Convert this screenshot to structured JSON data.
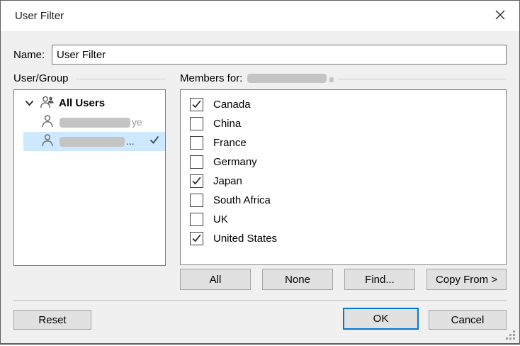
{
  "dialog": {
    "title": "User Filter"
  },
  "icons": {
    "close": "x-close",
    "tree_expander": "chevron-down",
    "group": "users-group",
    "user": "user-person",
    "selected_user_check": "check",
    "member_check": "check",
    "resize": "resize-grip"
  },
  "name_field": {
    "label": "Name:",
    "value": "User Filter"
  },
  "user_group_panel": {
    "label": "User/Group",
    "tree": [
      {
        "label": "All Users",
        "type": "group",
        "expanded": true,
        "redacted": false
      },
      {
        "type": "user",
        "redacted": true,
        "visible_suffix": "ye",
        "selected": false,
        "checked": false
      },
      {
        "type": "user",
        "redacted": true,
        "visible_suffix": "...",
        "selected": true,
        "checked": true
      }
    ]
  },
  "members_panel": {
    "label": "Members for:",
    "owner_redacted": true,
    "items": [
      {
        "label": "Canada",
        "checked": true
      },
      {
        "label": "China",
        "checked": false
      },
      {
        "label": "France",
        "checked": false
      },
      {
        "label": "Germany",
        "checked": false
      },
      {
        "label": "Japan",
        "checked": true
      },
      {
        "label": "South Africa",
        "checked": false
      },
      {
        "label": "UK",
        "checked": false
      },
      {
        "label": "United States",
        "checked": true
      }
    ],
    "buttons": [
      {
        "label": "All"
      },
      {
        "label": "None"
      },
      {
        "label": "Find..."
      },
      {
        "label": "Copy From >"
      }
    ]
  },
  "footer": {
    "reset_label": "Reset",
    "ok_label": "OK",
    "cancel_label": "Cancel"
  },
  "colors": {
    "accent": "#0078d7",
    "selection_bg": "#cde8ff",
    "dialog_bg": "#f0f0f0",
    "titlebar_bg": "#ffffff",
    "button_bg": "#e1e1e1",
    "button_border": "#a5a5a5",
    "box_border": "#7f7f7f",
    "redaction": "#c4c4c4",
    "tree_check": "#44546a"
  }
}
